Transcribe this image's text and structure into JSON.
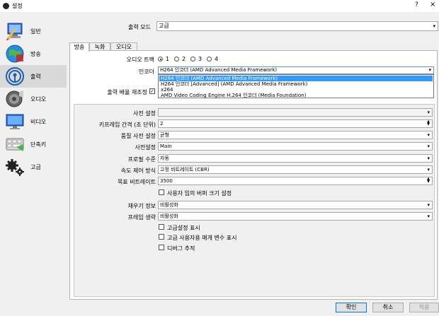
{
  "window": {
    "title": "설정",
    "help": "?",
    "close": "×"
  },
  "sidebar": {
    "items": [
      {
        "label": "일반",
        "icon": "general-icon"
      },
      {
        "label": "방송",
        "icon": "stream-icon"
      },
      {
        "label": "출력",
        "icon": "output-icon"
      },
      {
        "label": "오디오",
        "icon": "audio-icon"
      },
      {
        "label": "비디오",
        "icon": "video-icon"
      },
      {
        "label": "단축키",
        "icon": "hotkeys-icon"
      },
      {
        "label": "고급",
        "icon": "advanced-icon"
      }
    ],
    "active": "출력"
  },
  "output_mode": {
    "label": "출력 모드",
    "value": "고급"
  },
  "tabs": [
    "방송",
    "녹화",
    "오디오"
  ],
  "audio_track": {
    "label": "오디오 트랙",
    "options": [
      "1",
      "2",
      "3",
      "4"
    ],
    "selected": "1"
  },
  "encoder": {
    "label": "인코더",
    "value": "H264 인코더 (AMD Advanced Media Framework)",
    "options": [
      "H264 인코더 (AMD Advanced Media Framework)",
      "H264 인코더 [Advanced] (AMD Advanced Media Framework)",
      "x264",
      "AMD Video Coding Engine H.264 인코더 (Media Foundation)"
    ]
  },
  "rescale": {
    "label": "출력 배율 재조정"
  },
  "settings": {
    "preset": {
      "label": "사전 설정",
      "value": ""
    },
    "keyframe": {
      "label": "키프레임 간격 (초 단위)",
      "value": "2"
    },
    "quality_preset": {
      "label": "품질 사전 설정",
      "value": "균형"
    },
    "profile": {
      "label": "사전설정",
      "value": "Main"
    },
    "profile_level": {
      "label": "프로필 수준",
      "value": "자동"
    },
    "rate_control": {
      "label": "속도 제어 방식",
      "value": "고정 비트레이트 (CBR)"
    },
    "target_bitrate": {
      "label": "목표 비트레이트",
      "value": "3500"
    },
    "custom_buffer": {
      "label": "사용자 임의 버퍼 크기 설정"
    },
    "filler_data": {
      "label": "채우기 정보",
      "value": "비활성화"
    },
    "frame_skipping": {
      "label": "프레임 생략",
      "value": "비활성화"
    },
    "show_advanced": {
      "label": "고급설정 표시"
    },
    "show_expert": {
      "label": "고급 사용자용 매개 변수 표시"
    },
    "debug_tracing": {
      "label": "디버그 추적"
    }
  },
  "buttons": {
    "ok": "확인",
    "cancel": "취소",
    "apply": "적용"
  }
}
